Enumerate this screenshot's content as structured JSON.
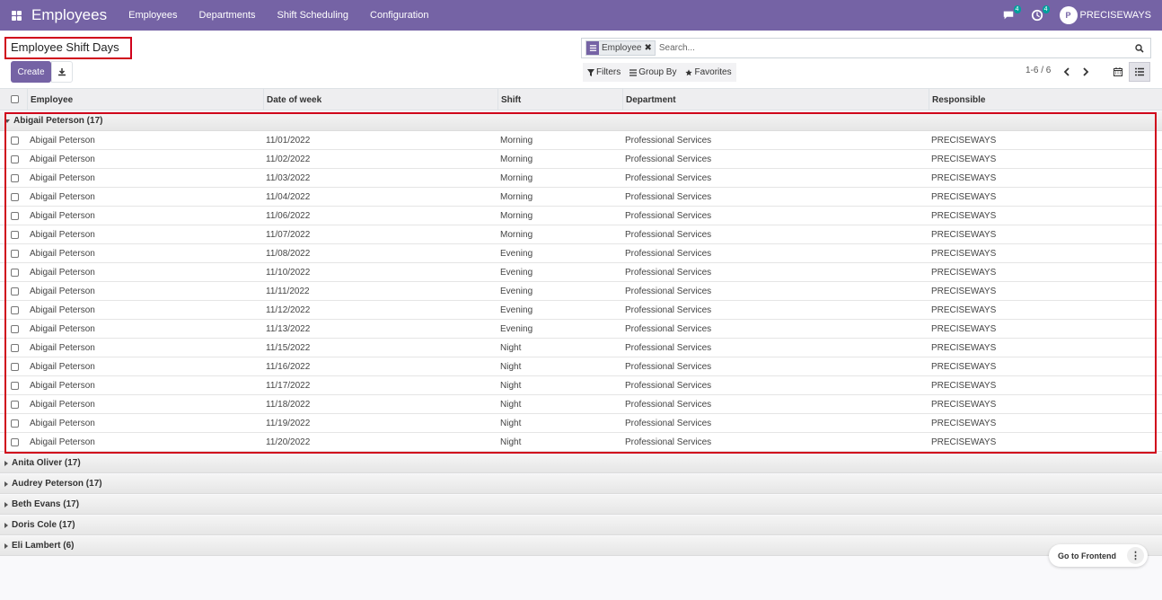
{
  "navbar": {
    "brand": "Employees",
    "menu": [
      "Employees",
      "Departments",
      "Shift Scheduling",
      "Configuration"
    ],
    "messages_badge": "4",
    "activity_badge": "4",
    "company": "PRECISEWAYS",
    "bg_color": "#7563a5"
  },
  "control_panel": {
    "title": "Employee Shift Days",
    "create_label": "Create",
    "search": {
      "facet_value": "Employee",
      "facet_remove": "✖",
      "placeholder": "Search..."
    },
    "filters_label": "Filters",
    "group_by_label": "Group By",
    "favorites_label": "Favorites",
    "pager": "1-6 / 6"
  },
  "table": {
    "headers": [
      "Employee",
      "Date of week",
      "Shift",
      "Department",
      "Responsible"
    ],
    "groups": [
      {
        "label": "Abigail Peterson (17)",
        "expanded": true,
        "rows": [
          [
            "Abigail Peterson",
            "11/01/2022",
            "Morning",
            "Professional Services",
            "PRECISEWAYS"
          ],
          [
            "Abigail Peterson",
            "11/02/2022",
            "Morning",
            "Professional Services",
            "PRECISEWAYS"
          ],
          [
            "Abigail Peterson",
            "11/03/2022",
            "Morning",
            "Professional Services",
            "PRECISEWAYS"
          ],
          [
            "Abigail Peterson",
            "11/04/2022",
            "Morning",
            "Professional Services",
            "PRECISEWAYS"
          ],
          [
            "Abigail Peterson",
            "11/06/2022",
            "Morning",
            "Professional Services",
            "PRECISEWAYS"
          ],
          [
            "Abigail Peterson",
            "11/07/2022",
            "Morning",
            "Professional Services",
            "PRECISEWAYS"
          ],
          [
            "Abigail Peterson",
            "11/08/2022",
            "Evening",
            "Professional Services",
            "PRECISEWAYS"
          ],
          [
            "Abigail Peterson",
            "11/10/2022",
            "Evening",
            "Professional Services",
            "PRECISEWAYS"
          ],
          [
            "Abigail Peterson",
            "11/11/2022",
            "Evening",
            "Professional Services",
            "PRECISEWAYS"
          ],
          [
            "Abigail Peterson",
            "11/12/2022",
            "Evening",
            "Professional Services",
            "PRECISEWAYS"
          ],
          [
            "Abigail Peterson",
            "11/13/2022",
            "Evening",
            "Professional Services",
            "PRECISEWAYS"
          ],
          [
            "Abigail Peterson",
            "11/15/2022",
            "Night",
            "Professional Services",
            "PRECISEWAYS"
          ],
          [
            "Abigail Peterson",
            "11/16/2022",
            "Night",
            "Professional Services",
            "PRECISEWAYS"
          ],
          [
            "Abigail Peterson",
            "11/17/2022",
            "Night",
            "Professional Services",
            "PRECISEWAYS"
          ],
          [
            "Abigail Peterson",
            "11/18/2022",
            "Night",
            "Professional Services",
            "PRECISEWAYS"
          ],
          [
            "Abigail Peterson",
            "11/19/2022",
            "Night",
            "Professional Services",
            "PRECISEWAYS"
          ],
          [
            "Abigail Peterson",
            "11/20/2022",
            "Night",
            "Professional Services",
            "PRECISEWAYS"
          ]
        ]
      },
      {
        "label": "Anita Oliver (17)",
        "expanded": false
      },
      {
        "label": "Audrey Peterson (17)",
        "expanded": false
      },
      {
        "label": "Beth Evans (17)",
        "expanded": false
      },
      {
        "label": "Doris Cole (17)",
        "expanded": false
      },
      {
        "label": "Eli Lambert (6)",
        "expanded": false
      }
    ]
  },
  "frontend_button": {
    "label": "Go to Frontend",
    "more": "⋮"
  },
  "icons": [
    "apps-grid-icon",
    "chat-icon",
    "activity-icon",
    "company-logo",
    "download-icon",
    "filter-icon",
    "group-by-icon",
    "star-icon",
    "search-icon",
    "chevron-left-icon",
    "chevron-right-icon",
    "calendar-icon",
    "list-icon"
  ]
}
